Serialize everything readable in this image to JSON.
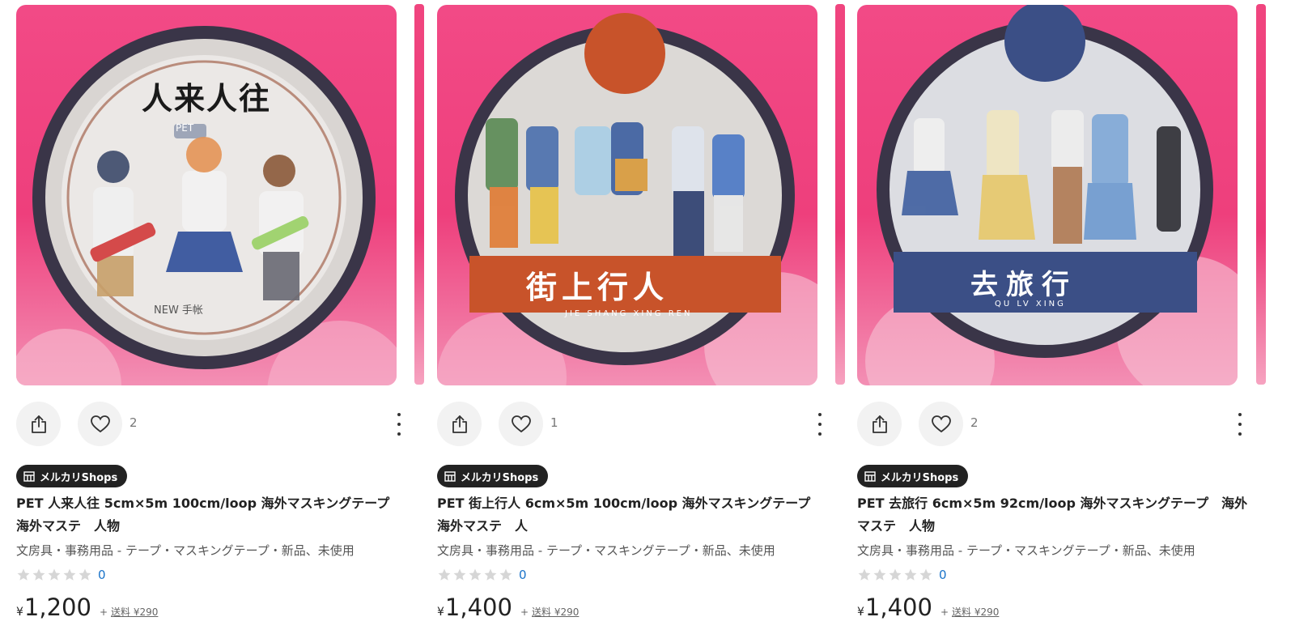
{
  "listings": [
    {
      "tape_title": "人来人往",
      "tape_sub": "NEW 手帐",
      "tape_tag": "PET",
      "like_count": "2",
      "shop_badge": "メルカリShops",
      "title": "PET 人来人往 5cm×5m 100cm/loop 海外マスキングテープ　海外マステ　人物",
      "category": "文房具・事務用品 - テープ・マスキングテープ・新品、未使用",
      "rating": 0,
      "rating_count": "0",
      "currency": "¥",
      "price": "1,200",
      "plus": "+",
      "shipping": "送料 ¥290"
    },
    {
      "tape_title": "街上行人",
      "tape_sub": "JIE SHANG XING REN",
      "like_count": "1",
      "shop_badge": "メルカリShops",
      "title": "PET 街上行人 6cm×5m 100cm/loop 海外マスキングテープ　海外マステ　人",
      "category": "文房具・事務用品 - テープ・マスキングテープ・新品、未使用",
      "rating": 0,
      "rating_count": "0",
      "currency": "¥",
      "price": "1,400",
      "plus": "+",
      "shipping": "送料 ¥290"
    },
    {
      "tape_title": "去旅行",
      "tape_sub": "QU LV XING",
      "like_count": "2",
      "shop_badge": "メルカリShops",
      "title": "PET 去旅行 6cm×5m 92cm/loop 海外マスキングテープ　海外マステ　人物",
      "category": "文房具・事務用品 - テープ・マスキングテープ・新品、未使用",
      "rating": 0,
      "rating_count": "0",
      "currency": "¥",
      "price": "1,400",
      "plus": "+",
      "shipping": "送料 ¥290"
    }
  ],
  "icons": {
    "share": "share-icon",
    "like": "heart-icon",
    "more": "more-vertical-icon",
    "shop": "shop-icon",
    "star": "star-icon"
  },
  "colors": {
    "photo_background": "#ee3f7c",
    "tape_band_1": "#c8532a",
    "tape_band_2": "#3b4f86",
    "star_empty": "#d6d6d6",
    "rating_count": "#1a73c9"
  }
}
